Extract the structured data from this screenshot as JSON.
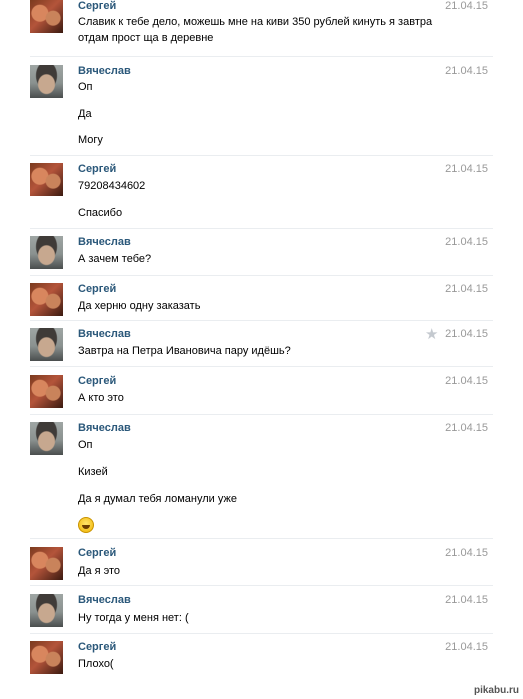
{
  "conversation": {
    "messages": [
      {
        "author": "Сергей",
        "date": "21.04.15",
        "lines": [
          "Славик к тебе дело, можешь мне на киви 350 рублей кинуть я завтра",
          "отдам прост ща в деревне"
        ]
      },
      {
        "author": "Вячеслав",
        "date": "21.04.15",
        "lines": [
          "Оп",
          "Да",
          "Могу"
        ]
      },
      {
        "author": "Сергей",
        "date": "21.04.15",
        "lines": [
          "79208434602",
          "Спасибо"
        ]
      },
      {
        "author": "Вячеслав",
        "date": "21.04.15",
        "lines": [
          "А зачем тебе?"
        ]
      },
      {
        "author": "Сергей",
        "date": "21.04.15",
        "lines": [
          "Да херню одну заказать"
        ]
      },
      {
        "author": "Вячеслав",
        "date": "21.04.15",
        "lines": [
          "Завтра на Петра Ивановича пару идёшь?"
        ]
      },
      {
        "author": "Сергей",
        "date": "21.04.15",
        "lines": [
          "А кто это"
        ]
      },
      {
        "author": "Вячеслав",
        "date": "21.04.15",
        "lines": [
          "Оп",
          "Кизей",
          "Да я думал тебя ломанули уже"
        ],
        "emoji": "smiley-icon"
      },
      {
        "author": "Сергей",
        "date": "21.04.15",
        "lines": [
          "Да я это"
        ]
      },
      {
        "author": "Вячеслав",
        "date": "21.04.15",
        "lines": [
          "Ну тогда у меня нет: ("
        ]
      },
      {
        "author": "Сергей",
        "date": "21.04.15",
        "lines": [
          "Плохо("
        ]
      }
    ]
  },
  "watermark": "pikabu.ru",
  "colors": {
    "author": "#2b587a",
    "date": "#999999",
    "star": "#c4c9cf"
  }
}
